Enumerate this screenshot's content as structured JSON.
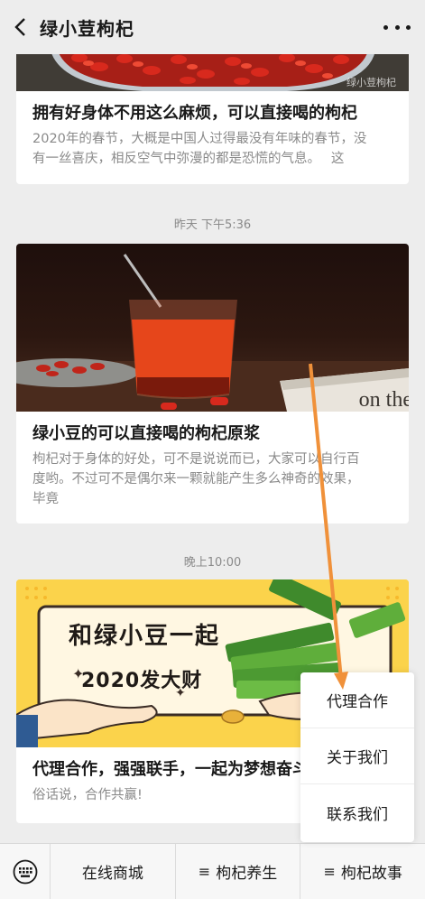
{
  "header": {
    "title": "绿小荳枸杞",
    "back_icon": "chevron-left-icon",
    "more_icon": "more-dots-icon"
  },
  "articles": [
    {
      "title": "拥有好身体不用这么麻烦，可以直接喝的枸杞",
      "desc_line1": "2020年的春节，大概是中国人过得最没有年味的春节，没",
      "desc_line2": "有一丝喜庆，相反空气中弥漫的都是恐慌的气息。　  这",
      "watermark": "绿小荳枸杞"
    },
    {
      "time": "昨天 下午5:36",
      "title": "绿小豆的可以直接喝的枸杞原浆",
      "desc_line1": "枸杞对于身体的好处，可不是说说而已，大家可以自行百",
      "desc_line2": "度哟。不过可不是偶尔来一颗就能产生多么神奇的效果，",
      "desc_line3": "毕竟",
      "book_text": "on the"
    },
    {
      "time": "晚上10:00",
      "banner_line1": "和绿小豆一起",
      "banner_line2": "2020发大财",
      "title": "代理合作，强强联手，一起为梦想奋斗",
      "desc": "俗话说，合作共赢!"
    }
  ],
  "bottom_menu": {
    "keyboard_icon": "keyboard-icon",
    "items": [
      {
        "label": "在线商城",
        "icon": ""
      },
      {
        "label": "枸杞养生",
        "icon": "≡"
      },
      {
        "label": "枸杞故事",
        "icon": "≡"
      }
    ]
  },
  "popup_menu": {
    "items": [
      "代理合作",
      "关于我们",
      "联系我们"
    ]
  },
  "colors": {
    "background": "#ededed",
    "arrow": "#f0913a",
    "banner": "#fbd34b"
  }
}
